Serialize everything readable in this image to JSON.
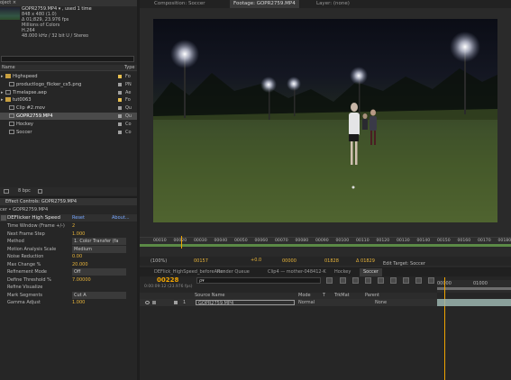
{
  "project_panel": {
    "tab_label": "oject ×",
    "selected_info": [
      "GOPR2759.MP4 ▾ , used 1 time",
      "848 x 480 (1.0)",
      "Δ 01;829, 23.976 fps",
      "Millions of Colors",
      "H.264",
      "48.000 kHz / 32 bit U / Stereo"
    ],
    "search_placeholder": "",
    "col_name": "Name",
    "col_type": "Type",
    "items": [
      {
        "name": "Highspeed",
        "type": "Fo",
        "swatch": "#e8c050",
        "indent": 0,
        "icon": "folder-icon"
      },
      {
        "name": "productlogo_flicker_cs5.png",
        "type": "PN",
        "swatch": "#a0a0a0",
        "indent": 1,
        "icon": "image-icon"
      },
      {
        "name": "Timelapse.aep",
        "type": "Ae",
        "swatch": "#a0a0a0",
        "indent": 0,
        "icon": "project-icon"
      },
      {
        "name": "tut0063",
        "type": "Fo",
        "swatch": "#e8c050",
        "indent": 0,
        "icon": "folder-icon"
      },
      {
        "name": "Clip #2.mov",
        "type": "Qu",
        "swatch": "#a0a0a0",
        "indent": 1,
        "icon": "video-icon"
      },
      {
        "name": "GOPR2759.MP4",
        "type": "Qu",
        "swatch": "#a0a0a0",
        "indent": 1,
        "icon": "video-icon",
        "selected": true
      },
      {
        "name": "Hockey",
        "type": "Co",
        "swatch": "#a0a0a0",
        "indent": 1,
        "icon": "composition-icon"
      },
      {
        "name": "Soccer",
        "type": "Co",
        "swatch": "#a0a0a0",
        "indent": 1,
        "icon": "composition-icon"
      }
    ],
    "bpc_label": "8 bpc"
  },
  "effect_controls": {
    "tab_label": "Effect Controls: GOPR2759.MP4",
    "breadcrumb": "cer • GOPR2759.MP4",
    "effect_name": "DEFlicker High Speed",
    "reset_label": "Reset",
    "about_label": "About...",
    "params": [
      {
        "label": "Time Window (Frame +/-)",
        "value": "2"
      },
      {
        "label": "Next Frame Step",
        "value": "1.000"
      },
      {
        "label": "Method",
        "value": "1. Color Transfer (fa"
      },
      {
        "label": "Motion Analysis Scale",
        "value": "Medium"
      },
      {
        "label": "Noise Reduction",
        "value": "0.00"
      },
      {
        "label": "Max Change %",
        "value": "20.000"
      },
      {
        "label": "Refinement Mode",
        "value": "Off"
      },
      {
        "label": "Define Threshold %",
        "value": "7.00000"
      },
      {
        "label": "Refine Visualize",
        "value": ""
      },
      {
        "label": "Mark Segments",
        "value": "Cut A"
      },
      {
        "label": "Gamma Adjust",
        "value": "1.000"
      }
    ]
  },
  "viewer": {
    "tabs": [
      "Composition: Soccer",
      "Footage: GOPR2759.MP4",
      "Layer: (none)"
    ],
    "timecodes": [
      "00010",
      "00020",
      "00030",
      "00040",
      "00050",
      "00060",
      "00070",
      "00080",
      "00090",
      "00100",
      "00110",
      "00120",
      "00130",
      "00140",
      "00150",
      "00160",
      "00170",
      "00180"
    ],
    "zoom": "(100%)",
    "current_frame": "00157",
    "start_frame": "00000",
    "end_frame": "01828",
    "duration": "Δ 01829",
    "edit_target": "Edit Target: Soccer",
    "offset": "+0.0"
  },
  "timeline": {
    "tabs": [
      "DEFlick_HighSpeed_beforeAfter",
      "Render Queue",
      "Clip4 — mother-048412-K",
      "Hockey",
      "Soccer"
    ],
    "current_time": "00228",
    "fps_info": "0:00:09:12 (23.976 fps)",
    "search_placeholder": "ρ▾",
    "col_source_name": "Source Name",
    "col_mode": "Mode",
    "col_t": "T",
    "col_trkmat": "TrkMat",
    "col_parent": "Parent",
    "layer": {
      "index": "1",
      "name": "GOPR2759.MP4",
      "mode": "Normal",
      "parent": "None"
    },
    "ruler_start": "00000",
    "ruler_mark": "01000"
  },
  "colors": {
    "accent_yellow": "#f0a400",
    "timecode_orange": "#e8b43a",
    "link_blue": "#78a8ff",
    "selection": "#4a4a4a"
  }
}
